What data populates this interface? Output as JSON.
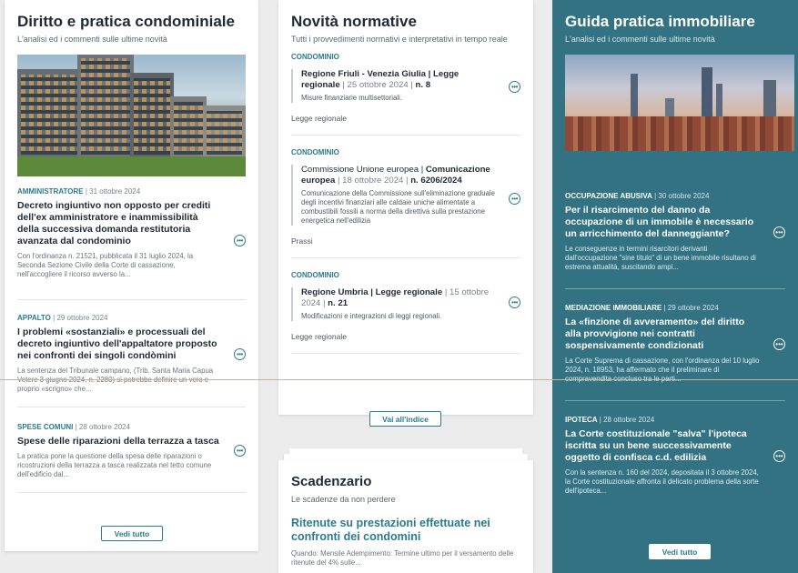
{
  "col1": {
    "title": "Diritto e pratica condominiale",
    "subtitle": "L'analisi ed i commenti sulle ultime novità",
    "articles": [
      {
        "category": "AMMINISTRATORE",
        "date": "31 ottobre 2024",
        "title": "Decreto ingiuntivo non opposto per crediti dell'ex amministratore e inammissibilità della successiva domanda restitutoria avanzata dal condominio",
        "desc": "Con l'ordinanza n. 21521, pubblicata il 31 luglio 2024, la Seconda Sezione Civile della Corte di cassazione, nell'accogliere il ricorso avverso la..."
      },
      {
        "category": "APPALTO",
        "date": "29 ottobre 2024",
        "title": "I problemi «sostanziali» e processuali del decreto ingiuntivo dell'appaltatore proposto nei confronti dei singoli condòmini",
        "desc": "La sentenza del Tribunale campano, (Trib. Santa Maria Capua Vetere 3 giugno 2024, n. 2280) si potrebbe definire un vero e proprio «scrigno» che..."
      },
      {
        "category": "SPESE COMUNI",
        "date": "28 ottobre 2024",
        "title": "Spese delle riparazioni della terrazza a tasca",
        "desc": "La pratica pone la questione della spesa delle riparazioni o ricostruzioni della terrazza a tasca realizzata nel tetto comune dell'edificio dal..."
      }
    ],
    "button": "Vedi tutto"
  },
  "col2": {
    "title": "Novità normative",
    "subtitle": "Tutti i provvedimenti normativi e interpretativi in tempo reale",
    "items": [
      {
        "category": "CONDOMINIO",
        "title_strong": "Regione Friuli - Venezia Giulia | Legge regionale",
        "title_date": " | 25 ottobre 2024 | ",
        "title_num": "n. 8",
        "desc": "Misure finanziarie multisettoriali.",
        "type": "Legge regionale"
      },
      {
        "category": "CONDOMINIO",
        "title_plain": "Commissione Unione europea | ",
        "title_strong": "Comunicazione europea",
        "title_date": " | 18 ottobre 2024 | ",
        "title_num": "n. 6206/2024",
        "desc": "Comunicazione della Commissione sull'eliminazione graduale degli incentivi finanziari alle caldaie uniche alimentate a combustibili fossili a norma della direttiva sulla prestazione energetica nell'edilizia",
        "type": "Prassi"
      },
      {
        "category": "CONDOMINIO",
        "title_strong": "Regione Umbria | Legge regionale",
        "title_date": " | 15 ottobre 2024 | ",
        "title_num": "n. 21",
        "desc": "Modificazioni e integrazioni di leggi regionali.",
        "type": "Legge regionale"
      }
    ],
    "button": "Vai all'indice"
  },
  "scadenzario": {
    "title": "Scadenzario",
    "subtitle": "Le scadenze da non perdere",
    "item_title": "Ritenute su prestazioni effettuate nei confronti dei condomini",
    "item_desc": "Quando: Mensile Adempimento: Termine ultimo per il versamento delle ritenute del 4% sulle..."
  },
  "col3": {
    "title": "Guida pratica immobiliare",
    "subtitle": "L'analisi ed i commenti sulle ultime novità",
    "articles": [
      {
        "category": "OCCUPAZIONE ABUSIVA",
        "date": "30 ottobre 2024",
        "title": "Per il risarcimento del danno da occupazione di un immobile è necessario un arricchimento del danneggiante?",
        "desc": "Le conseguenze in termini risarcitori derivanti dall'occupazione \"sine titulo\" di un bene immobile risultano di estrema attualità, suscitando ampi..."
      },
      {
        "category": "MEDIAZIONE IMMOBILIARE",
        "date": "29 ottobre 2024",
        "title": "La «finzione di avveramento» del diritto alla provvigione nei contratti sospensivamente condizionati",
        "desc": "La Corte Suprema di cassazione, con l'ordinanza del 10 luglio 2024, n. 18953, ha affermato che il preliminare di compravendita concluso tra le parti..."
      },
      {
        "category": "IPOTECA",
        "date": "28 ottobre 2024",
        "title": "La Corte costituzionale \"salva\" l'ipoteca iscritta su un bene successivamente oggetto di confisca c.d. edilizia",
        "desc": "Con la sentenza n. 160 del 2024, depositata il 3 ottobre 2024, la Corte costituzionale affronta il delicato problema della sorte dell'ipoteca..."
      }
    ],
    "button": "Vedi tutto"
  },
  "icons": {
    "more": "more-icon",
    "separator": "|"
  }
}
